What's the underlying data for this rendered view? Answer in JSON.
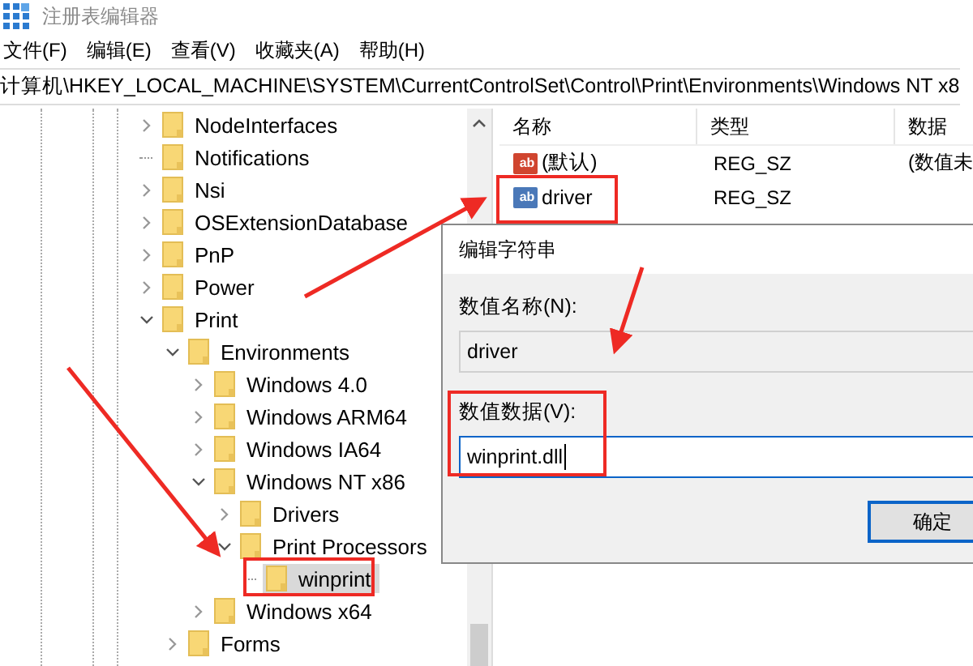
{
  "window": {
    "title": "注册表编辑器"
  },
  "menu": [
    "文件(F)",
    "编辑(E)",
    "查看(V)",
    "收藏夹(A)",
    "帮助(H)"
  ],
  "address": "计算机\\HKEY_LOCAL_MACHINE\\SYSTEM\\CurrentControlSet\\Control\\Print\\Environments\\Windows NT x8",
  "tree": [
    {
      "label": "NodeInterfaces",
      "expandable": true,
      "expanded": false,
      "selected": false
    },
    {
      "label": "Notifications",
      "expandable": false,
      "expanded": false,
      "selected": false
    },
    {
      "label": "Nsi",
      "expandable": true,
      "expanded": false,
      "selected": false
    },
    {
      "label": "OSExtensionDatabase",
      "expandable": true,
      "expanded": false,
      "selected": false
    },
    {
      "label": "PnP",
      "expandable": true,
      "expanded": false,
      "selected": false
    },
    {
      "label": "Power",
      "expandable": true,
      "expanded": false,
      "selected": false
    },
    {
      "label": "Print",
      "expandable": true,
      "expanded": true,
      "selected": false,
      "children": [
        {
          "label": "Environments",
          "expandable": true,
          "expanded": true,
          "selected": false,
          "children": [
            {
              "label": "Windows 4.0",
              "expandable": true,
              "expanded": false,
              "selected": false
            },
            {
              "label": "Windows ARM64",
              "expandable": true,
              "expanded": false,
              "selected": false
            },
            {
              "label": "Windows IA64",
              "expandable": true,
              "expanded": false,
              "selected": false
            },
            {
              "label": "Windows NT x86",
              "expandable": true,
              "expanded": true,
              "selected": false,
              "children": [
                {
                  "label": "Drivers",
                  "expandable": true,
                  "expanded": false,
                  "selected": false
                },
                {
                  "label": "Print Processors",
                  "expandable": true,
                  "expanded": true,
                  "selected": false,
                  "children": [
                    {
                      "label": "winprint",
                      "expandable": false,
                      "expanded": false,
                      "selected": true
                    }
                  ]
                }
              ]
            },
            {
              "label": "Windows x64",
              "expandable": true,
              "expanded": false,
              "selected": false
            }
          ]
        },
        {
          "label": "Forms",
          "expandable": true,
          "expanded": false,
          "selected": false
        }
      ]
    }
  ],
  "values": {
    "columns": [
      "名称",
      "类型",
      "数据"
    ],
    "rows": [
      {
        "name": "(默认)",
        "type": "REG_SZ",
        "data": "(数值未",
        "icon_text": "ab",
        "color": "#d0452f"
      },
      {
        "name": "driver",
        "type": "REG_SZ",
        "data": "",
        "icon_text": "ab",
        "color": "#4a78b8"
      }
    ]
  },
  "dialog": {
    "title": "编辑字符串",
    "name_label": "数值名称(N):",
    "name_value": "driver",
    "data_label": "数值数据(V):",
    "data_value": "winprint.dll",
    "ok": "确定"
  }
}
